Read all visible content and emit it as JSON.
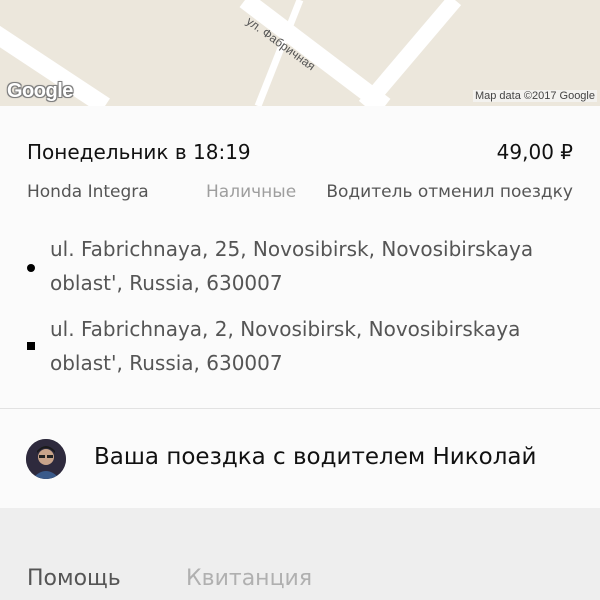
{
  "map": {
    "street_label": "ул. Фабричная",
    "google_logo": "Google",
    "attribution": "Map data ©2017 Google",
    "background_color": "#ece7dc"
  },
  "trip": {
    "datetime": "Понедельник в 18:19",
    "price": "49,00 ₽",
    "car": "Honda Integra",
    "payment": "Наличные",
    "status": "Водитель отменил поездку",
    "pickup_address": "ul. Fabrichnaya, 25, Novosibirsk, Novosibirskaya oblast', Russia, 630007",
    "dropoff_address": "ul. Fabrichnaya, 2, Novosibirsk, Novosibirskaya oblast', Russia, 630007"
  },
  "driver": {
    "text": "Ваша поездка с водителем Николай"
  },
  "tabs": {
    "help": "Помощь",
    "receipt": "Квитанция"
  }
}
